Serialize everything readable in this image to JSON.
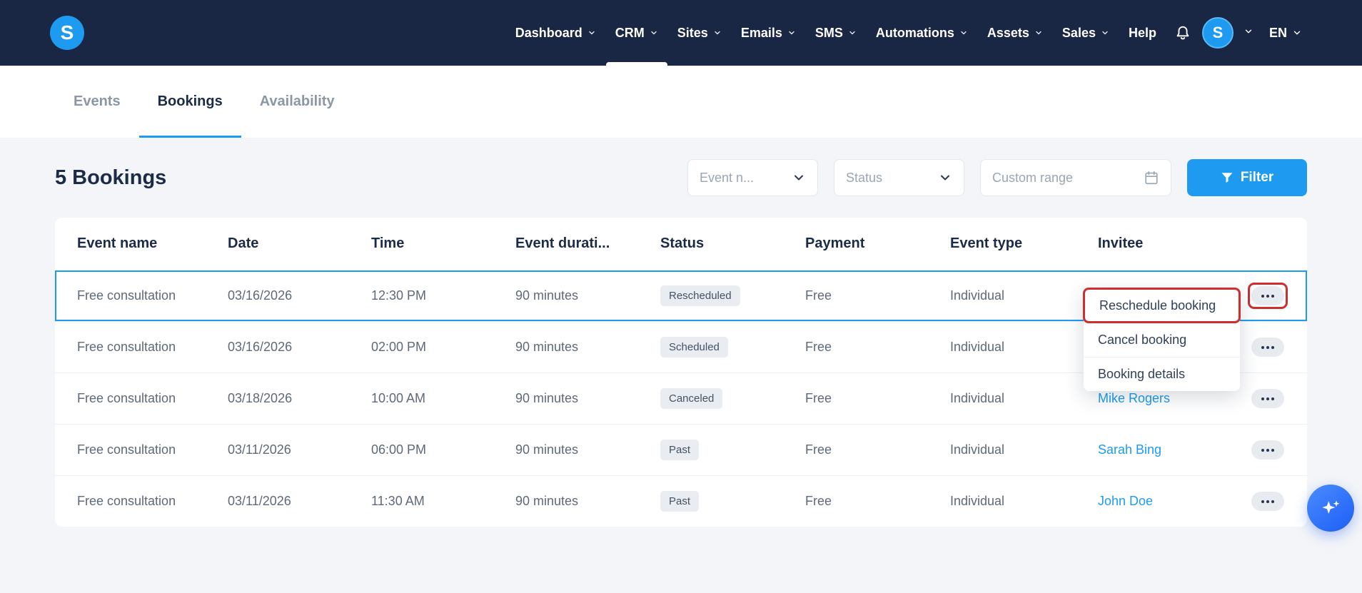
{
  "colors": {
    "navbar": "#1a2744",
    "accent": "#1e9bf0",
    "annotation": "#cf2e2e",
    "page_bg": "#f3f5f8",
    "link": "#1e9bf0",
    "heading": "#1c2b47"
  },
  "brand": {
    "logo_letter": "S"
  },
  "navbar": {
    "items": [
      {
        "label": "Dashboard",
        "has_chevron": true,
        "active": false
      },
      {
        "label": "CRM",
        "has_chevron": true,
        "active": true
      },
      {
        "label": "Sites",
        "has_chevron": true,
        "active": false
      },
      {
        "label": "Emails",
        "has_chevron": true,
        "active": false
      },
      {
        "label": "SMS",
        "has_chevron": true,
        "active": false
      },
      {
        "label": "Automations",
        "has_chevron": true,
        "active": false
      },
      {
        "label": "Assets",
        "has_chevron": true,
        "active": false
      },
      {
        "label": "Sales",
        "has_chevron": true,
        "active": false
      },
      {
        "label": "Help",
        "has_chevron": false,
        "active": false
      }
    ],
    "avatar_letter": "S",
    "language": "EN"
  },
  "tabs": [
    {
      "label": "Events",
      "active": false
    },
    {
      "label": "Bookings",
      "active": true
    },
    {
      "label": "Availability",
      "active": false
    }
  ],
  "toolbar": {
    "heading": "5 Bookings",
    "event_filter_placeholder": "Event n...",
    "status_filter_placeholder": "Status",
    "date_range_placeholder": "Custom range",
    "filter_button_label": "Filter"
  },
  "table": {
    "columns": [
      "Event name",
      "Date",
      "Time",
      "Event durati...",
      "Status",
      "Payment",
      "Event type",
      "Invitee"
    ],
    "rows": [
      {
        "event_name": "Free consultation",
        "date": "03/16/2026",
        "time": "12:30 PM",
        "duration": "90 minutes",
        "status": "Rescheduled",
        "payment": "Free",
        "event_type": "Individual",
        "invitee": "",
        "selected": true,
        "action_annotated": true
      },
      {
        "event_name": "Free consultation",
        "date": "03/16/2026",
        "time": "02:00 PM",
        "duration": "90 minutes",
        "status": "Scheduled",
        "payment": "Free",
        "event_type": "Individual",
        "invitee": "",
        "selected": false,
        "action_annotated": false
      },
      {
        "event_name": "Free consultation",
        "date": "03/18/2026",
        "time": "10:00 AM",
        "duration": "90 minutes",
        "status": "Canceled",
        "payment": "Free",
        "event_type": "Individual",
        "invitee": "Mike Rogers",
        "selected": false,
        "action_annotated": false
      },
      {
        "event_name": "Free consultation",
        "date": "03/11/2026",
        "time": "06:00 PM",
        "duration": "90 minutes",
        "status": "Past",
        "payment": "Free",
        "event_type": "Individual",
        "invitee": "Sarah Bing",
        "selected": false,
        "action_annotated": false
      },
      {
        "event_name": "Free consultation",
        "date": "03/11/2026",
        "time": "11:30 AM",
        "duration": "90 minutes",
        "status": "Past",
        "payment": "Free",
        "event_type": "Individual",
        "invitee": "John Doe",
        "selected": false,
        "action_annotated": false
      }
    ]
  },
  "context_menu": {
    "items": [
      {
        "label": "Reschedule booking",
        "highlighted": true
      },
      {
        "label": "Cancel booking",
        "highlighted": false
      },
      {
        "label": "Booking details",
        "highlighted": false
      }
    ]
  }
}
